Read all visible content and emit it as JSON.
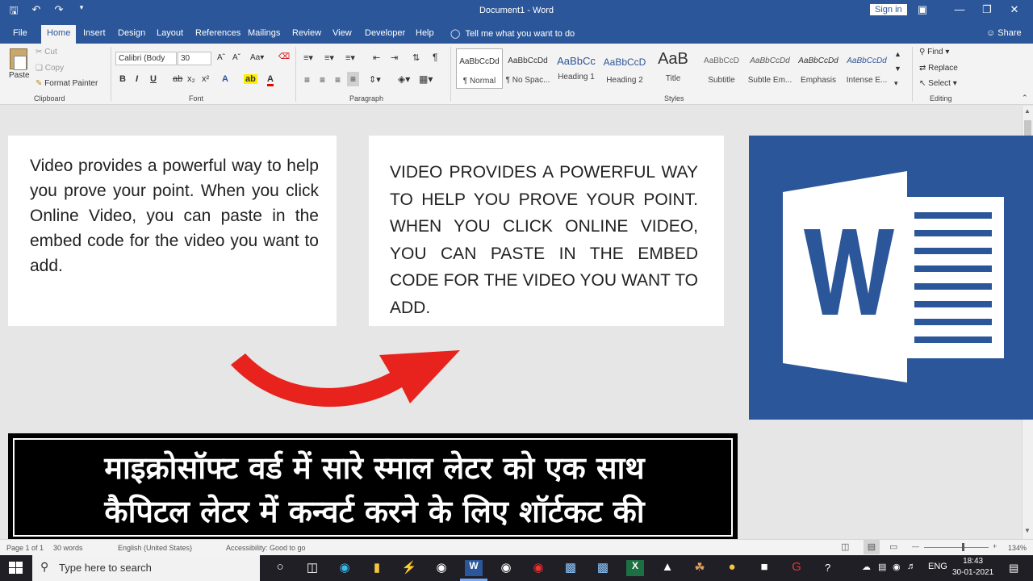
{
  "titlebar": {
    "doc_title": "Document1  -  Word",
    "signin_label": "Sign in",
    "qat": {
      "save_icon": "save-icon",
      "undo_icon": "undo-icon",
      "redo_icon": "redo-icon"
    }
  },
  "tabs": {
    "file": "File",
    "home": "Home",
    "insert": "Insert",
    "design": "Design",
    "layout": "Layout",
    "references": "References",
    "mailings": "Mailings",
    "review": "Review",
    "view": "View",
    "developer": "Developer",
    "help": "Help",
    "tellme": "Tell me what you want to do",
    "share": "Share"
  },
  "ribbon": {
    "clipboard": {
      "paste": "Paste",
      "cut": "Cut",
      "copy": "Copy",
      "format_painter": "Format Painter",
      "label": "Clipboard"
    },
    "font": {
      "name": "Calibri (Body",
      "size": "30",
      "label": "Font"
    },
    "paragraph": {
      "label": "Paragraph"
    },
    "styles": {
      "label": "Styles",
      "items": [
        {
          "sample": "AaBbCcDd",
          "name": "¶ Normal"
        },
        {
          "sample": "AaBbCcDd",
          "name": "¶ No Spac..."
        },
        {
          "sample": "AaBbCc",
          "name": "Heading 1"
        },
        {
          "sample": "AaBbCcD",
          "name": "Heading 2"
        },
        {
          "sample": "AaB",
          "name": "Title"
        },
        {
          "sample": "AaBbCcD",
          "name": "Subtitle"
        },
        {
          "sample": "AaBbCcDd",
          "name": "Subtle Em..."
        },
        {
          "sample": "AaBbCcDd",
          "name": "Emphasis"
        },
        {
          "sample": "AaBbCcDd",
          "name": "Intense E..."
        }
      ]
    },
    "editing": {
      "find": "Find",
      "replace": "Replace",
      "select": "Select",
      "label": "Editing"
    }
  },
  "document": {
    "text_normal": "Video provides a powerful way to help you prove your point. When you click Online Video, you can paste in the embed code for the video you want to add.",
    "text_upper": "VIDEO PROVIDES A POWERFUL WAY TO HELP YOU PROVE YOUR POINT. WHEN YOU CLICK ONLINE VIDEO, YOU CAN PASTE IN THE EMBED CODE FOR THE VIDEO YOU WANT TO ADD."
  },
  "banner": {
    "line1": "माइक्रोसॉफ्ट वर्ड में सारे स्माल लेटर को एक साथ",
    "line2": "कैपिटल लेटर में कन्वर्ट करने के लिए शॉर्टकट की"
  },
  "statusbar": {
    "page": "Page 1 of 1",
    "words": "30 words",
    "language": "English (United States)",
    "accessibility": "Accessibility: Good to go",
    "zoom": "134%"
  },
  "taskbar": {
    "search_placeholder": "Type here to search",
    "lang": "ENG",
    "time": "18:43",
    "date": "30-01-2021"
  },
  "colors": {
    "word_blue": "#2b579a",
    "arrow_red": "#e8231e"
  }
}
